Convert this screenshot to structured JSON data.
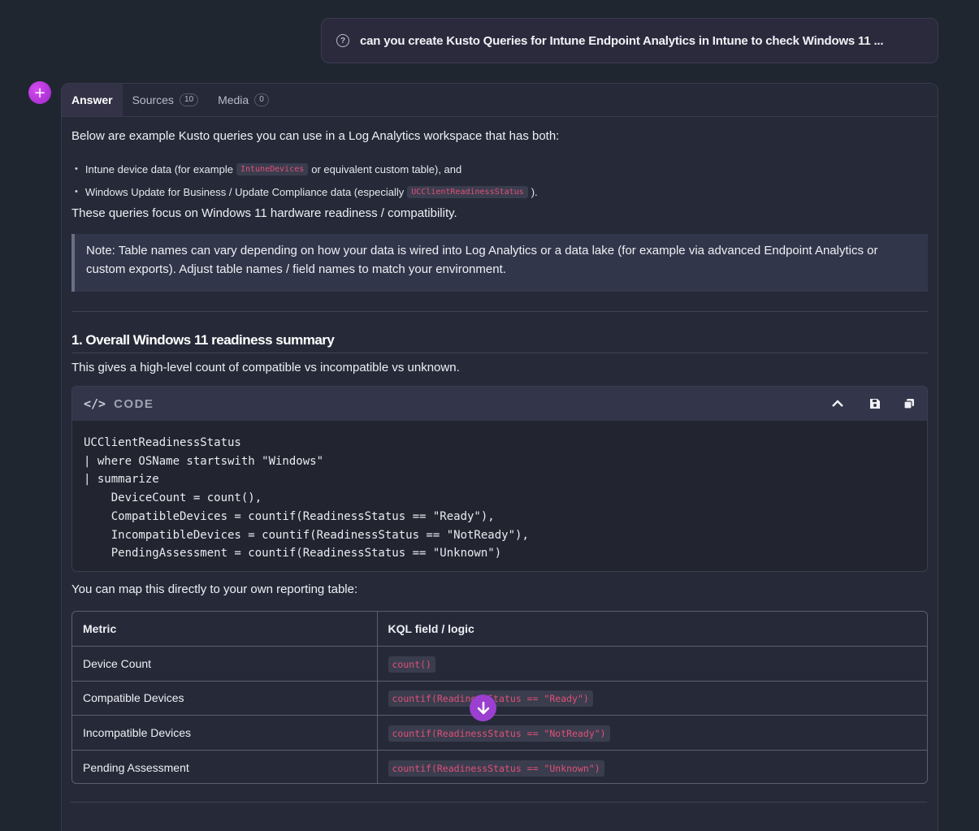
{
  "question": {
    "icon": "question-circle-icon",
    "text": "can you create Kusto Queries for Intune Endpoint Analytics in Intune to check Windows 11 ..."
  },
  "avatar": {
    "icon": "plus-icon",
    "glyph": "+"
  },
  "tabs": [
    {
      "label": "Answer",
      "active": true
    },
    {
      "label": "Sources",
      "count": "10"
    },
    {
      "label": "Media",
      "count": "0"
    }
  ],
  "answer": {
    "intro": "Below are example Kusto queries you can use in a Log Analytics workspace that has both:",
    "bullets": [
      {
        "before": "Intune device data (for example",
        "code": "IntuneDevices",
        "after": "or equivalent custom table), and"
      },
      {
        "before": "Windows Update for Business / Update Compliance data (especially",
        "code": "UCClientReadinessStatus",
        "after": ")."
      }
    ],
    "focus": "These queries focus on Windows 11 hardware readiness / compatibility.",
    "note": "Note: Table names can vary depending on how your data is wired into Log Analytics or a data lake (for example via advanced Endpoint Analytics or custom exports). Adjust table names / field names to match your environment.",
    "section_heading": "1. Overall Windows 11 readiness summary",
    "section_intro": "This gives a high-level count of compatible vs incompatible vs unknown.",
    "code_block": {
      "label": "CODE",
      "code": "UCClientReadinessStatus\n| where OSName startswith \"Windows\"\n| summarize\n    DeviceCount = count(),\n    CompatibleDevices = countif(ReadinessStatus == \"Ready\"),\n    IncompatibleDevices = countif(ReadinessStatus == \"NotReady\"),\n    PendingAssessment = countif(ReadinessStatus == \"Unknown\")",
      "buttons": [
        "chevron-up-icon",
        "save-icon",
        "copy-icon"
      ]
    },
    "map_intro": "You can map this directly to your own reporting table:",
    "table": {
      "headers": [
        "Metric",
        "KQL field / logic"
      ],
      "rows": [
        [
          "Device Count",
          "count()"
        ],
        [
          "Compatible Devices",
          "countif(ReadinessStatus == \"Ready\")"
        ],
        [
          "Incompatible Devices",
          "countif(ReadinessStatus == \"NotReady\")"
        ],
        [
          "Pending Assessment",
          "countif(ReadinessStatus == \"Unknown\")"
        ]
      ]
    }
  },
  "scroll_button": {
    "icon": "arrow-down-icon"
  },
  "colors": {
    "background": "#1f2630",
    "card": "#262a38",
    "accent": "#9b3fd0",
    "inline_code": "#e0507a"
  }
}
